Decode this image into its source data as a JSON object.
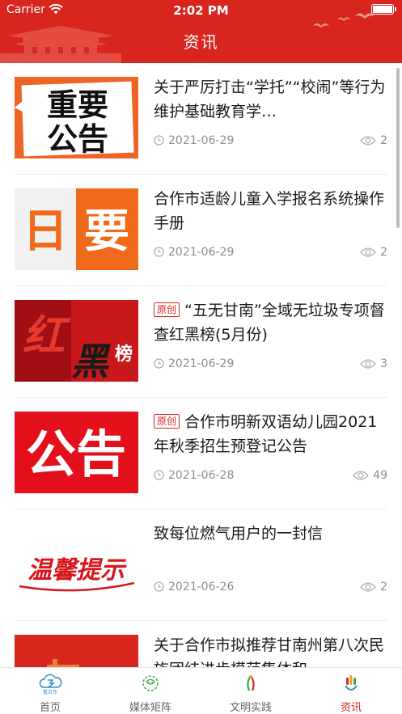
{
  "status_bar": {
    "carrier": "Carrier",
    "time": "2:02 PM"
  },
  "header": {
    "title": "资讯",
    "color": "#d8261f"
  },
  "articles": [
    {
      "thumb_line1": "重要",
      "thumb_line2": "公告",
      "badge": "",
      "title": "关于严厉打击“学托”“校闹”等行为 维护基础教育学…",
      "date": "2021-06-29",
      "views": "2"
    },
    {
      "thumb_line1": "日",
      "thumb_line2": "要",
      "badge": "",
      "title": "合作市适龄儿童入学报名系统操作手册",
      "date": "2021-06-29",
      "views": "2"
    },
    {
      "thumb_line1": "红",
      "thumb_line2": "黑",
      "thumb_line3": "榜",
      "badge": "原创",
      "title": "“五无甘南”全域无垃圾专项督查红黑榜(5月份)",
      "date": "2021-06-29",
      "views": "3"
    },
    {
      "thumb_line1": "公告",
      "badge": "原创",
      "title": "合作市明新双语幼儿园2021年秋季招生预登记公告",
      "date": "2021-06-28",
      "views": "49"
    },
    {
      "thumb_line1": "温馨提示",
      "badge": "",
      "title": "致每位燃气用户的一封信",
      "date": "2021-06-26",
      "views": "2"
    },
    {
      "badge": "",
      "title": "关于合作市拟推荐甘南州第八次民族团结进步模范集体和",
      "date": "",
      "views": ""
    }
  ],
  "tabs": [
    {
      "label": "首页",
      "icon": "home-cloud-icon",
      "logo_text": "看合作"
    },
    {
      "label": "媒体矩阵",
      "icon": "media-matrix-icon"
    },
    {
      "label": "文明实践",
      "icon": "civilization-practice-icon"
    },
    {
      "label": "资讯",
      "icon": "news-icon",
      "active": true
    }
  ]
}
